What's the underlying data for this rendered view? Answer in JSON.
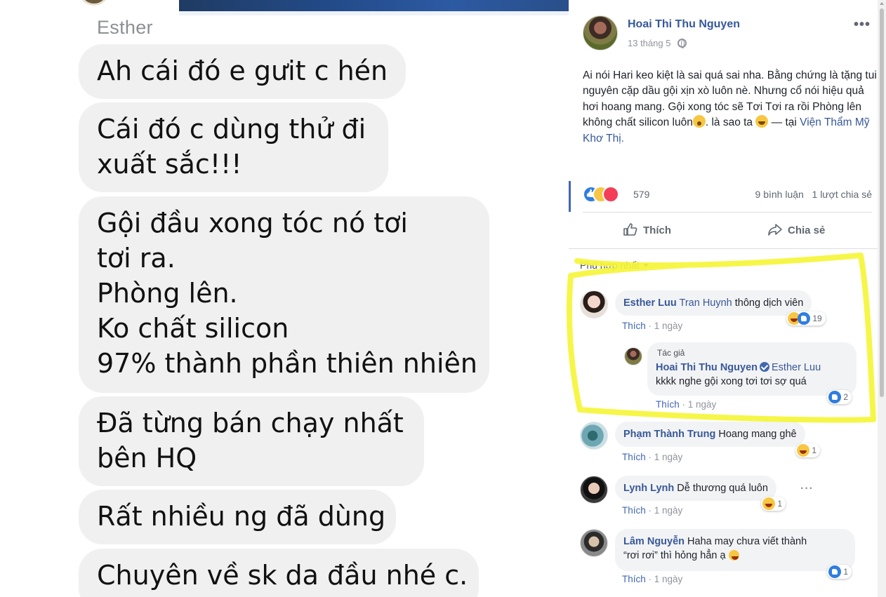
{
  "chat": {
    "sender": "Esther",
    "messages": [
      {
        "lines": [
          "Ah cái đó e gưit c hén"
        ]
      },
      {
        "lines": [
          "Cái đó c dùng thử đi",
          "xuất sắc!!!"
        ]
      },
      {
        "lines": [
          "Gội đầu xong tóc nó tơi",
          "tơi ra.",
          "Phòng lên.",
          "Ko chất silicon",
          "97% thành phần thiên nhiên"
        ]
      },
      {
        "lines": [
          "Đã từng bán chạy nhất",
          "bên HQ"
        ]
      },
      {
        "lines": [
          "Rất nhiều ng đã dùng"
        ]
      },
      {
        "lines": [
          "Chuyên về sk da đầu nhé c."
        ]
      }
    ]
  },
  "post": {
    "author": "Hoai Thi Thu Nguyen",
    "date": "13 tháng 5",
    "privacy_icon": "globe-icon",
    "more_label": "•••",
    "text_main": "Ai nói Hari keo kiệt là sai quá sai nha. Bằng chứng là tặng tui nguyên cặp dầu gội xịn xò luôn nè. Nhưng cổ nói hiệu quả hơi hoang mang. Gội xong tóc sẽ Tơi Tơi ra rồi Phòng lên không chất silicon luôn",
    "text_tail_a": ".",
    "text_tail_b": "là sao ta",
    "text_dash": " — tại ",
    "location": "Viện Thẩm Mỹ Khơ Thị.",
    "reactions_count": "579",
    "comments_count": "9 bình luận",
    "shares_count": "1 lượt chia sẻ",
    "like_label": "Thích",
    "share_label": "Chia sẻ",
    "sort_label": "Phù hợp nhất"
  },
  "comments": [
    {
      "name": "Esther Luu",
      "tag": "Tran Huynh",
      "text": "thông dịch viên",
      "like": "Thích",
      "time": "1 ngày",
      "reaction_count": "19",
      "reactions": [
        "haha-icon",
        "like-icon"
      ]
    },
    {
      "badge": "Tác giả",
      "name": "Hoai Thi Thu Nguyen",
      "tag": "Esther Luu",
      "text": "kkkk nghe gội xong tơi tơi sợ quá",
      "like": "Thích",
      "time": "1 ngày",
      "reaction_count": "2",
      "reactions": [
        "like-icon"
      ]
    },
    {
      "name": "Phạm Thành Trung",
      "text": "Hoang mang ghê",
      "like": "Thích",
      "time": "1 ngày",
      "reaction_count": "1",
      "reactions": [
        "haha-icon"
      ]
    },
    {
      "name": "Lynh Lynh",
      "text": "Dễ thương quá luôn",
      "like": "Thích",
      "time": "1 ngày",
      "reaction_count": "1",
      "reactions": [
        "haha-icon"
      ]
    },
    {
      "name": "Lâm Nguyễn",
      "text_line1": "Haha may chưa viết thành",
      "text_line2": "“rơi rơi” thì hỏng hẳn ạ",
      "like": "Thích",
      "time": "1 ngày",
      "reaction_count": "1",
      "reactions": [
        "like-icon"
      ]
    }
  ],
  "colors": {
    "link": "#385898",
    "highlight": "#f5f53a",
    "bubble": "#f0f0f0"
  }
}
